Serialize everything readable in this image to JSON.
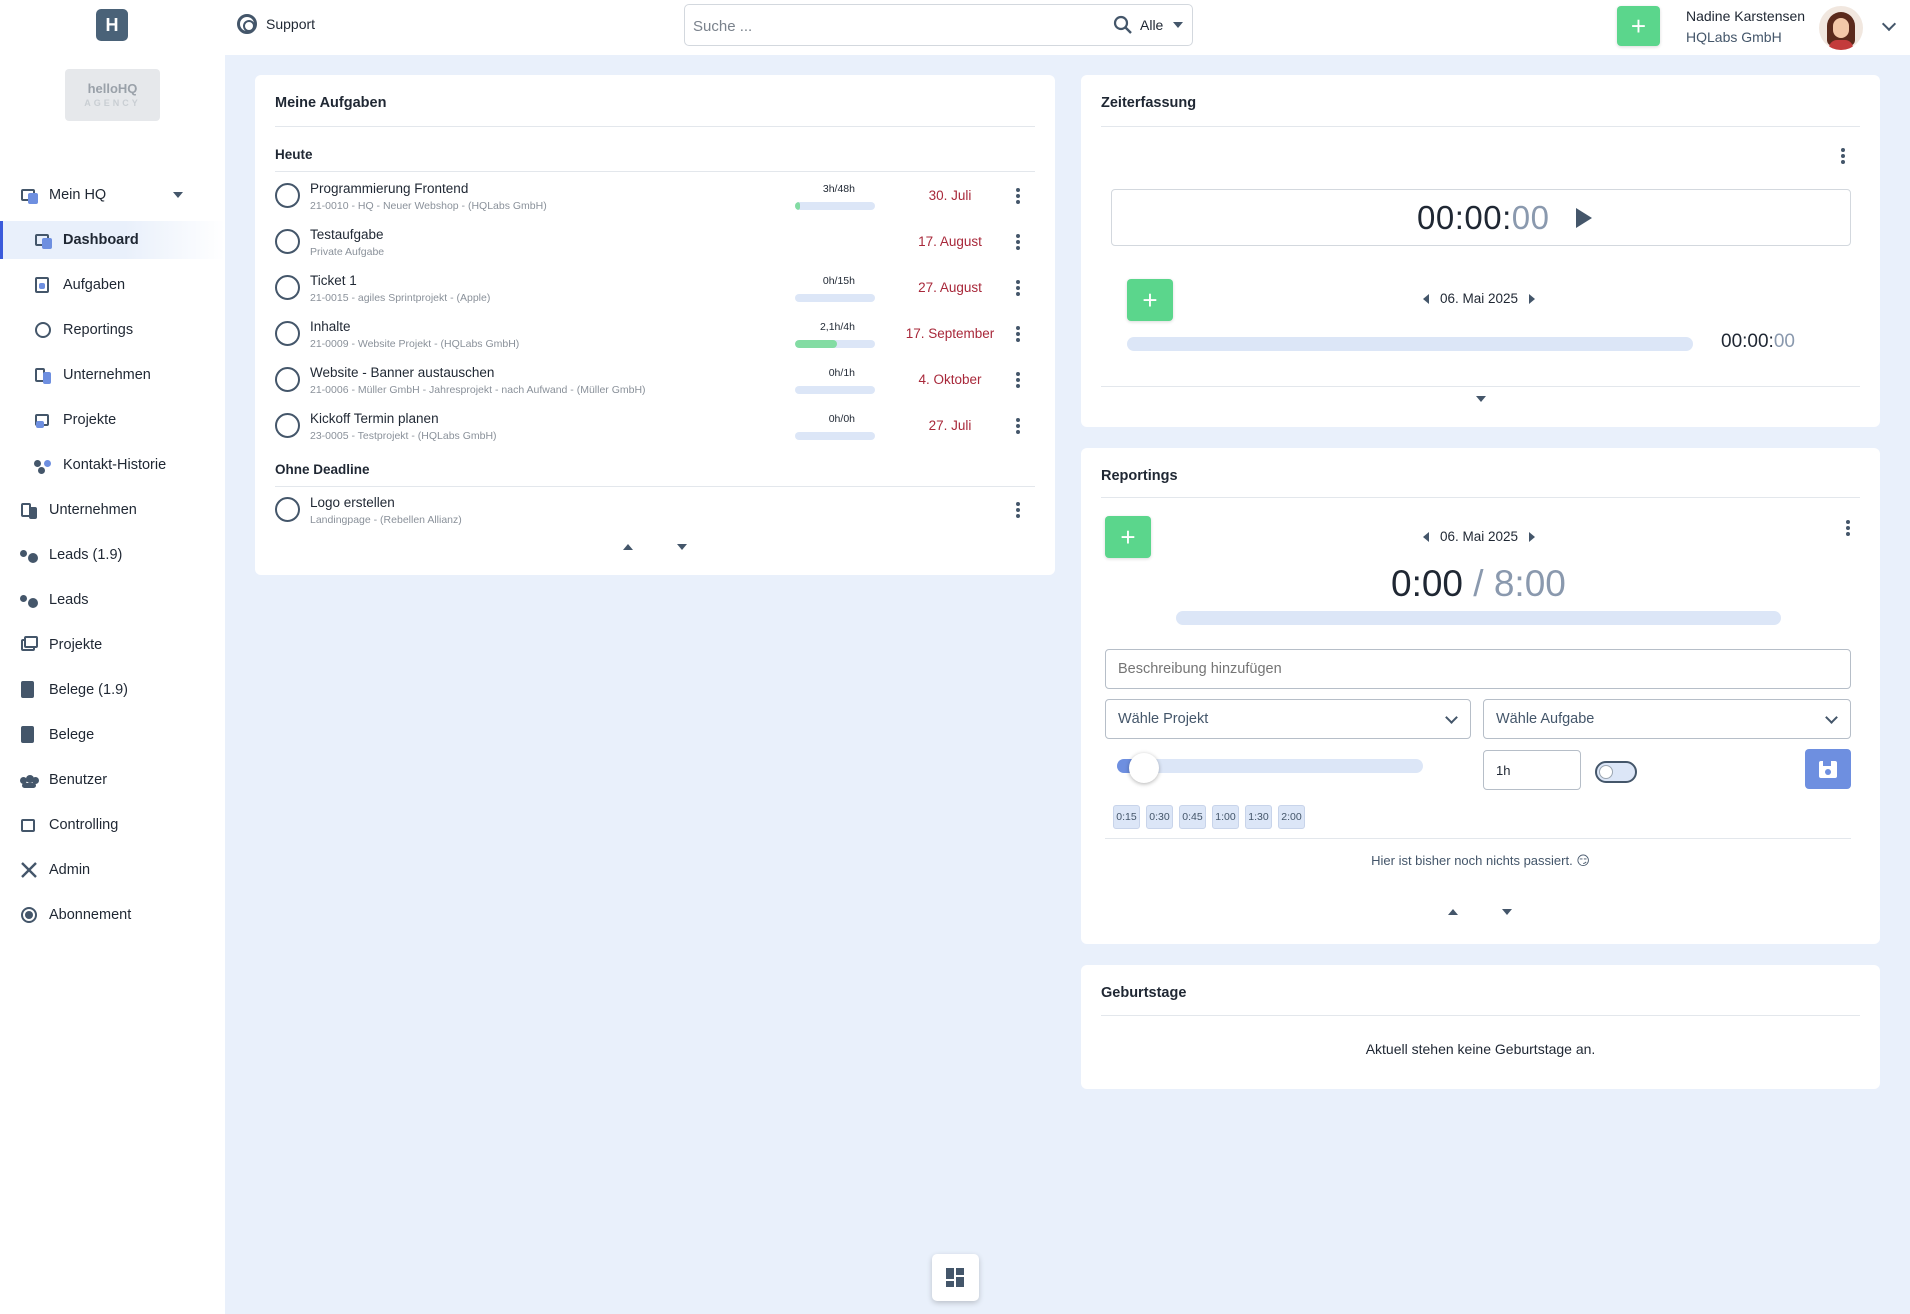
{
  "topbar": {
    "logo_text": "H",
    "support_label": "Support",
    "search": {
      "placeholder": "Suche ...",
      "value": "",
      "scope": "Alle"
    },
    "add_label": "+",
    "user": {
      "name": "Nadine Karstensen",
      "company": "HQLabs GmbH"
    }
  },
  "sidebar": {
    "agency_logo": {
      "line1": "helloHQ",
      "line2": "AGENCY"
    },
    "items": [
      {
        "label": "Mein HQ",
        "icon": "dashboard-icon"
      },
      {
        "label": "Dashboard",
        "icon": "dashboard-icon",
        "active": true
      },
      {
        "label": "Aufgaben",
        "icon": "clipboard-check-icon"
      },
      {
        "label": "Reportings",
        "icon": "stopwatch-icon"
      },
      {
        "label": "Unternehmen",
        "icon": "company-icon"
      },
      {
        "label": "Projekte",
        "icon": "projects-icon"
      },
      {
        "label": "Kontakt-Historie",
        "icon": "contacts-history-icon"
      },
      {
        "label": "Unternehmen",
        "icon": "company-icon"
      },
      {
        "label": "Leads (1.9)",
        "icon": "leads-icon"
      },
      {
        "label": "Leads",
        "icon": "leads-icon"
      },
      {
        "label": "Projekte",
        "icon": "projects-icon"
      },
      {
        "label": "Belege (1.9)",
        "icon": "document-icon"
      },
      {
        "label": "Belege",
        "icon": "document-icon"
      },
      {
        "label": "Benutzer",
        "icon": "users-icon"
      },
      {
        "label": "Controlling",
        "icon": "presentation-icon"
      },
      {
        "label": "Admin",
        "icon": "tools-icon"
      },
      {
        "label": "Abonnement",
        "icon": "subscription-icon"
      }
    ]
  },
  "tasks": {
    "title": "Meine Aufgaben",
    "today_label": "Heute",
    "no_deadline_label": "Ohne Deadline",
    "today": [
      {
        "name": "Programmierung Frontend",
        "sub": "21-0010 - HQ - Neuer Webshop - (HQLabs GmbH)",
        "hours": "3h/48h",
        "progress": 0.06,
        "due": "30. Juli"
      },
      {
        "name": "Testaufgabe",
        "sub": "Private Aufgabe",
        "hours": "",
        "progress": null,
        "due": "17. August"
      },
      {
        "name": "Ticket 1",
        "sub": "21-0015 - agiles Sprintprojekt - (Apple)",
        "hours": "0h/15h",
        "progress": 0,
        "due": "27. August"
      },
      {
        "name": "Inhalte",
        "sub": "21-0009 - Website Projekt - (HQLabs GmbH)",
        "hours": "2,1h/4h",
        "progress": 0.525,
        "due": "17. September"
      },
      {
        "name": "Website - Banner austauschen",
        "sub": "21-0006 - Müller GmbH - Jahresprojekt - nach Aufwand - (Müller GmbH)",
        "hours": "0h/1h",
        "progress": 0,
        "due": "4. Oktober"
      },
      {
        "name": "Kickoff Termin planen",
        "sub": "23-0005 - Testprojekt - (HQLabs GmbH)",
        "hours": "0h/0h",
        "progress": 0,
        "due": "27. Juli"
      }
    ],
    "no_deadline": [
      {
        "name": "Logo erstellen",
        "sub": "Landingpage - (Rebellen Allianz)"
      }
    ]
  },
  "time_tracking": {
    "title": "Zeiterfassung",
    "timer_main": "00:00",
    "timer_sep": ":",
    "timer_seconds": "00",
    "add_label": "+",
    "date": "06. Mai 2025",
    "total_main": "00:00",
    "total_sep": ":",
    "total_seconds": "00"
  },
  "reportings": {
    "title": "Reportings",
    "add_label": "+",
    "date": "06. Mai 2025",
    "logged": "0:00",
    "separator": "/",
    "target": "8:00",
    "description_placeholder": "Beschreibung hinzufügen",
    "project_placeholder": "Wähle Projekt",
    "task_placeholder": "Wähle Aufgabe",
    "duration_value": "1h",
    "slider_fraction": 0.08,
    "quick_durations": [
      "0:15",
      "0:30",
      "0:45",
      "1:00",
      "1:30",
      "2:00"
    ],
    "empty_message": "Hier ist bisher noch nichts passiert. 😏"
  },
  "birthdays": {
    "title": "Geburtstage",
    "empty_message": "Aktuell stehen keine Geburtstage an."
  },
  "colors": {
    "accent_green": "#5bd68c",
    "accent_blue": "#6e8fe0",
    "due_red": "#a8283a",
    "background": "#e9f0fb"
  }
}
